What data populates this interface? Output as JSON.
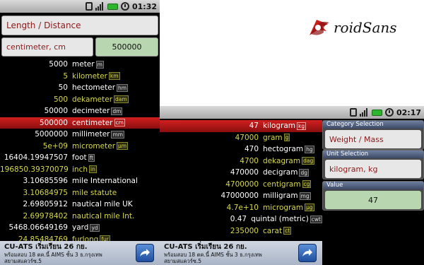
{
  "logo": {
    "text": "DroidSans",
    "accent": "#c81e1e"
  },
  "left_phone": {
    "status_time": "01:32",
    "category": "Length / Distance",
    "unit": "centimeter, cm",
    "input_value": "500000",
    "rows": [
      {
        "value": "5000",
        "unit": "meter",
        "abbr": "m",
        "style": "white"
      },
      {
        "value": "5",
        "unit": "kilometer",
        "abbr": "km",
        "style": "yellow"
      },
      {
        "value": "50",
        "unit": "hectometer",
        "abbr": "hm",
        "style": "white"
      },
      {
        "value": "500",
        "unit": "dekameter",
        "abbr": "dam",
        "style": "yellow"
      },
      {
        "value": "50000",
        "unit": "decimeter",
        "abbr": "dm",
        "style": "white"
      },
      {
        "value": "500000",
        "unit": "centimeter",
        "abbr": "cm",
        "style": "selected"
      },
      {
        "value": "5000000",
        "unit": "millimeter",
        "abbr": "mm",
        "style": "white"
      },
      {
        "value": "5e+09",
        "unit": "micrometer",
        "abbr": "µm",
        "style": "yellow"
      },
      {
        "value": "16404.19947507",
        "unit": "foot",
        "abbr": "ft",
        "style": "white"
      },
      {
        "value": "196850.39370079",
        "unit": "inch",
        "abbr": "in",
        "style": "yellow"
      },
      {
        "value": "3.10685596",
        "unit": "mile International",
        "abbr": "",
        "style": "white"
      },
      {
        "value": "3.10684975",
        "unit": "mile statute",
        "abbr": "",
        "style": "yellow"
      },
      {
        "value": "2.69805912",
        "unit": "nautical mile UK",
        "abbr": "",
        "style": "white"
      },
      {
        "value": "2.69978402",
        "unit": "nautical mile Int.",
        "abbr": "",
        "style": "yellow"
      },
      {
        "value": "5468.06649169",
        "unit": "yard",
        "abbr": "yd",
        "style": "white"
      },
      {
        "value": "24.85484769",
        "unit": "furlong",
        "abbr": "fur",
        "style": "yellow"
      }
    ]
  },
  "right_phone": {
    "status_time": "02:17",
    "rows": [
      {
        "value": "47",
        "unit": "kilogram",
        "abbr": "kg",
        "style": "selected"
      },
      {
        "value": "47000",
        "unit": "gram",
        "abbr": "g",
        "style": "yellow"
      },
      {
        "value": "470",
        "unit": "hectogram",
        "abbr": "hg",
        "style": "white"
      },
      {
        "value": "4700",
        "unit": "dekagram",
        "abbr": "dag",
        "style": "yellow"
      },
      {
        "value": "470000",
        "unit": "decigram",
        "abbr": "dg",
        "style": "white"
      },
      {
        "value": "4700000",
        "unit": "centigram",
        "abbr": "cg",
        "style": "yellow"
      },
      {
        "value": "47000000",
        "unit": "milligram",
        "abbr": "mg",
        "style": "white"
      },
      {
        "value": "4.7e+10",
        "unit": "microgram",
        "abbr": "µg",
        "style": "yellow"
      },
      {
        "value": "0.47",
        "unit": "quintal (metric)",
        "abbr": "cwt",
        "style": "white"
      },
      {
        "value": "235000",
        "unit": "carat",
        "abbr": "ct",
        "style": "yellow"
      }
    ],
    "category_title": "Category Selection",
    "category_value": "Weight / Mass",
    "unit_title": "Unit Selection",
    "unit_value": "kilogram, kg",
    "value_title": "Value",
    "value_value": "47"
  },
  "ad": {
    "title": "CU-ATS เริ่มเรียน 26 กย.",
    "line1": "พร้อมสอบ 18 ตค.นี้ AIMS ชั้น 3 ธ.กรุงเทพ",
    "line2": "สยามสแควร์ซ.5"
  }
}
